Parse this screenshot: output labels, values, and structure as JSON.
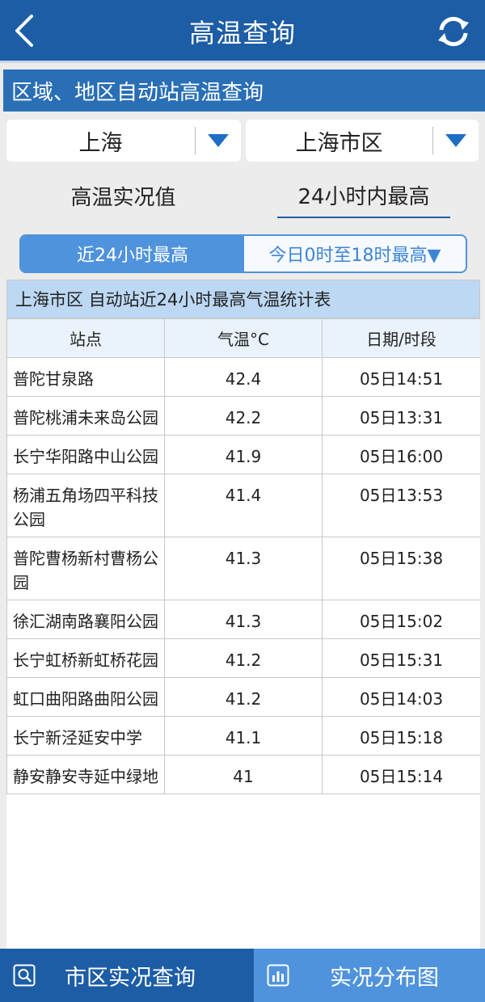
{
  "header": {
    "title": "高温查询",
    "back_icon": "chevron-left-icon",
    "refresh_icon": "refresh-icon"
  },
  "section": {
    "title": "区域、地区自动站高温查询"
  },
  "filters": {
    "region": "上海",
    "district": "上海市区"
  },
  "view_tabs": {
    "tab1": "高温实况值",
    "tab2": "24小时内最高",
    "active": "tab2"
  },
  "segment": {
    "option1": "近24小时最高",
    "option2": "今日0时至18时最高▼",
    "active": "option1"
  },
  "table": {
    "caption": "上海市区 自动站近24小时最高气温统计表",
    "headers": [
      "站点",
      "气温°C",
      "日期/时段"
    ],
    "rows": [
      {
        "station": "普陀甘泉路",
        "temp": "42.4",
        "time": "05日14:51"
      },
      {
        "station": "普陀桃浦未来岛公园",
        "temp": "42.2",
        "time": "05日13:31"
      },
      {
        "station": "长宁华阳路中山公园",
        "temp": "41.9",
        "time": "05日16:00"
      },
      {
        "station": "杨浦五角场四平科技公园",
        "temp": "41.4",
        "time": "05日13:53"
      },
      {
        "station": "普陀曹杨新村曹杨公园",
        "temp": "41.3",
        "time": "05日15:38"
      },
      {
        "station": "徐汇湖南路襄阳公园",
        "temp": "41.3",
        "time": "05日15:02"
      },
      {
        "station": "长宁虹桥新虹桥花园",
        "temp": "41.2",
        "time": "05日15:31"
      },
      {
        "station": "虹口曲阳路曲阳公园",
        "temp": "41.2",
        "time": "05日14:03"
      },
      {
        "station": "长宁新泾延安中学",
        "temp": "41.1",
        "time": "05日15:18"
      },
      {
        "station": "静安静安寺延中绿地",
        "temp": "41",
        "time": "05日15:14"
      }
    ]
  },
  "bottom_nav": {
    "item1": "市区实况查询",
    "item2": "实况分布图"
  },
  "colors": {
    "primary": "#1d5da6",
    "accent": "#4f93dc",
    "caption_bg": "#bcd8f3"
  }
}
